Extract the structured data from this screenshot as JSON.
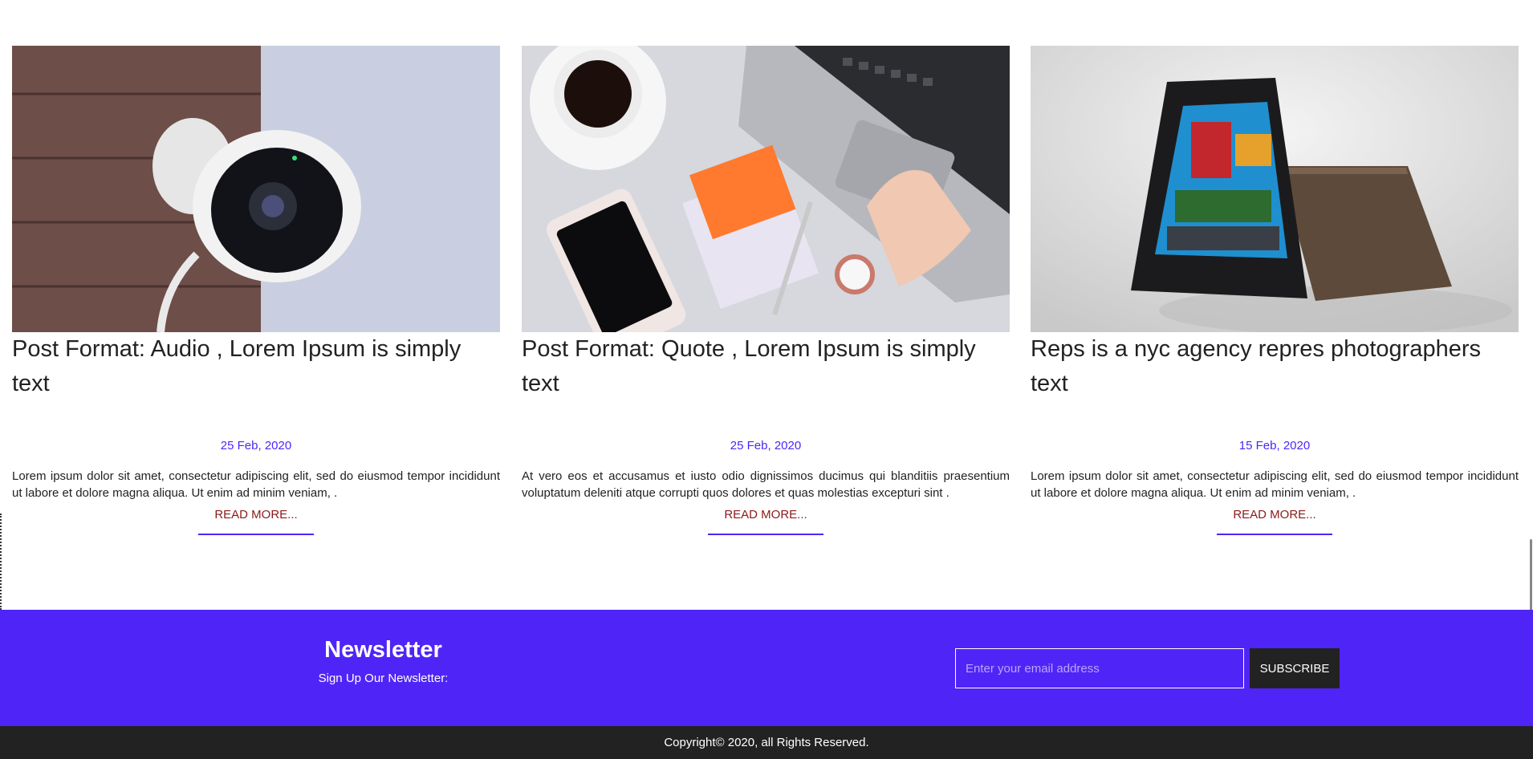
{
  "posts": [
    {
      "image_icon": "security-camera-image",
      "title": "Post Format: Audio , Lorem Ipsum is simply text",
      "date": "25 Feb, 2020",
      "excerpt": "Lorem ipsum dolor sit amet, consectetur adipiscing elit, sed do eiusmod tempor incididunt ut labore et dolore magna aliqua. Ut enim ad minim veniam, .",
      "read_more": "READ MORE..."
    },
    {
      "image_icon": "desk-laptop-image",
      "title": "Post Format: Quote , Lorem Ipsum is simply text",
      "date": "25 Feb, 2020",
      "excerpt": "At vero eos et accusamus et iusto odio dignissimos ducimus qui blanditiis praesentium voluptatum deleniti atque corrupti quos dolores et quas molestias excepturi sint .",
      "read_more": "READ MORE..."
    },
    {
      "image_icon": "tablets-image",
      "title": "Reps is a nyc agency repres photographers text",
      "date": "15 Feb, 2020",
      "excerpt": "Lorem ipsum dolor sit amet, consectetur adipiscing elit, sed do eiusmod tempor incididunt ut labore et dolore magna aliqua. Ut enim ad minim veniam, .",
      "read_more": "READ MORE..."
    }
  ],
  "newsletter": {
    "title": "Newsletter",
    "subtitle": "Sign Up Our Newsletter:",
    "email_placeholder": "Enter your email address",
    "subscribe_label": "SUBSCRIBE"
  },
  "footer": {
    "copyright": "Copyright© 2020, all Rights Reserved."
  },
  "colors": {
    "accent": "#4f25f7",
    "dark": "#222222",
    "read_more": "#8b1a1a"
  }
}
